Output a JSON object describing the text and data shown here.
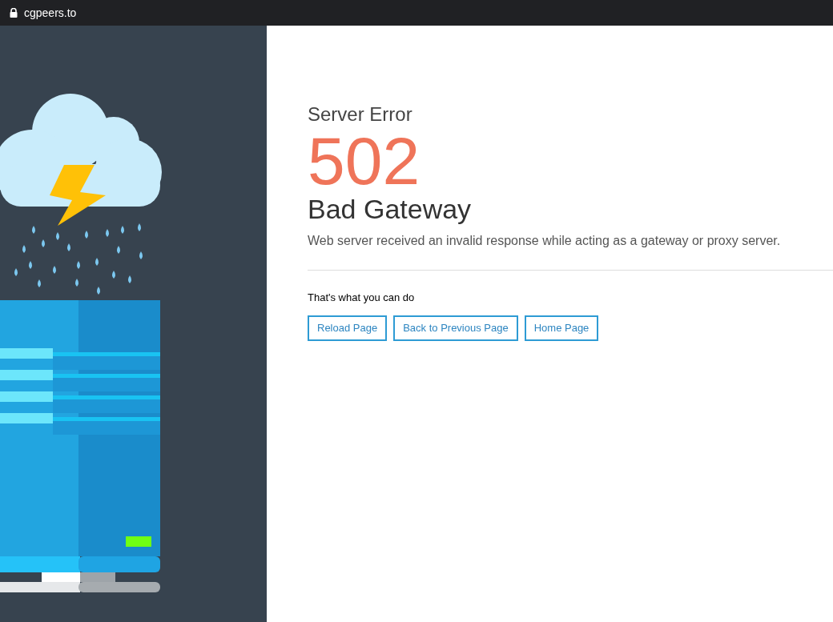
{
  "address_bar": {
    "url": "cgpeers.to"
  },
  "error": {
    "heading": "Server Error",
    "code": "502",
    "title": "Bad Gateway",
    "description": "Web server received an invalid response while acting as a gateway or proxy server."
  },
  "actions": {
    "label": "That's what you can do",
    "buttons": [
      "Reload Page",
      "Back to Previous Page",
      "Home Page"
    ]
  }
}
